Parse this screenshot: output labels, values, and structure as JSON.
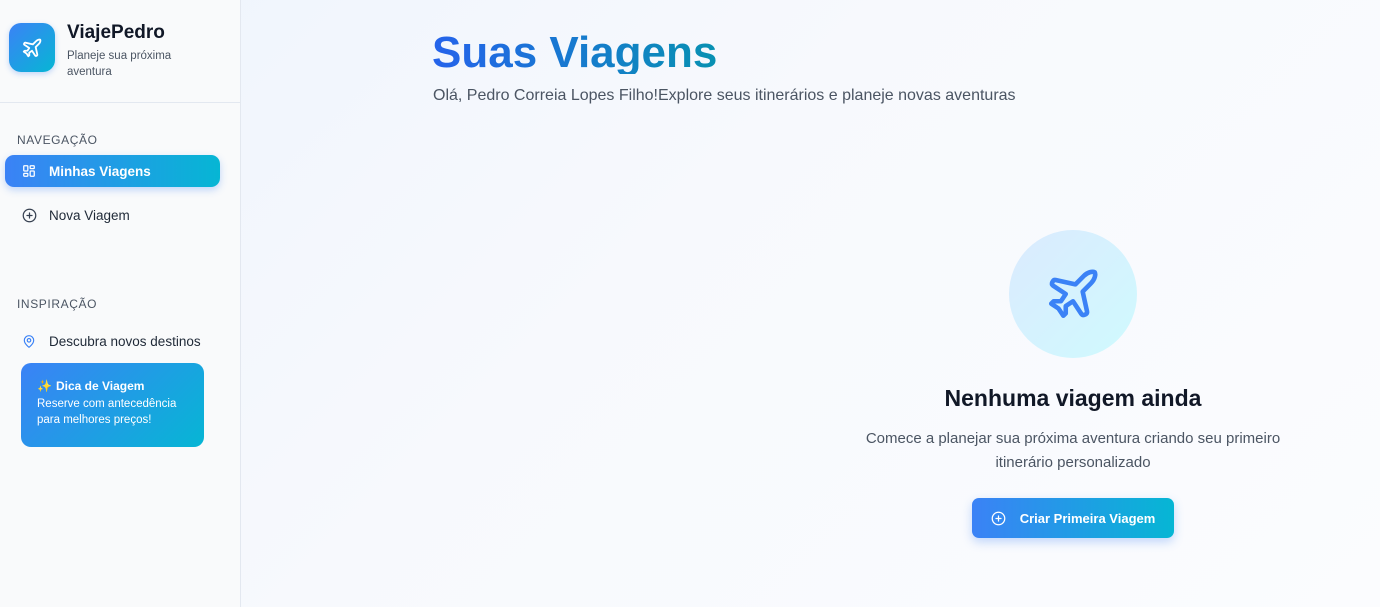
{
  "brand": {
    "name": "ViajePedro",
    "tagline": "Planeje sua próxima aventura",
    "icon": "plane-icon"
  },
  "sidebar": {
    "nav_label": "NAVEGAÇÃO",
    "nav_items": [
      {
        "label": "Minhas Viagens",
        "icon": "grid-icon",
        "active": true
      },
      {
        "label": "Nova Viagem",
        "icon": "plus-circle-icon",
        "active": false
      }
    ],
    "inspiration_label": "INSPIRAÇÃO",
    "inspiration_item": {
      "label": "Descubra novos destinos",
      "icon": "map-pin-icon"
    },
    "tip": {
      "icon": "sparkles-icon",
      "title": "Dica de Viagem",
      "body": "Reserve com antecedência para melhores preços!"
    }
  },
  "main": {
    "title": "Suas Viagens",
    "subtitle": "Olá, Pedro Correia Lopes Filho!Explore seus itinerários e planeje novas aventuras",
    "empty_state": {
      "icon": "plane-icon",
      "title": "Nenhuma viagem ainda",
      "description": "Comece a planejar sua próxima aventura criando seu primeiro itinerário personalizado",
      "button_label": "Criar Primeira Viagem",
      "button_icon": "plus-circle-icon"
    }
  },
  "colors": {
    "accent_start": "#3b82f6",
    "accent_end": "#06b6d4",
    "title_start": "#2563eb",
    "title_end": "#0891b2"
  }
}
